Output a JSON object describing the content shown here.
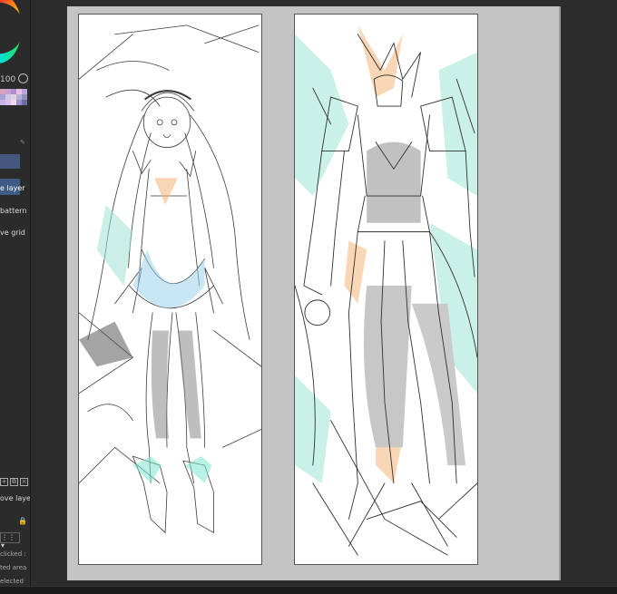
{
  "left_panel": {
    "zoom_value": "100",
    "menu_items": [
      {
        "label": "e layer",
        "active": true
      },
      {
        "label": "battern",
        "active": false
      },
      {
        "label": "ve grid",
        "active": false
      }
    ],
    "layer_label": "ove layer",
    "list_items": [
      {
        "label": "clicked :"
      },
      {
        "label": "ted area"
      },
      {
        "label": "elected"
      }
    ],
    "swatch_colors": [
      "#d9a0c0",
      "#c9a0d6",
      "#a78fd0",
      "#e7c0e0",
      "#b5a6e0",
      "#a89ed8",
      "#d0c6e6",
      "#e5d0e8",
      "#b0b0d0",
      "#8f8fc0",
      "#c9b7e3",
      "#d8c0f0",
      "#f0d8e8",
      "#9a8fcf",
      "#6c6ca0"
    ]
  },
  "canvas": {
    "panels": [
      {
        "name": "left-illustration",
        "subject": "girl figure sketch"
      },
      {
        "name": "right-illustration",
        "subject": "armored mech knight sketch"
      }
    ],
    "accent_colors": {
      "teal": "#7fe6d0",
      "orange": "#f5b57a",
      "blue": "#8ecbe6",
      "gray": "#8a8a8a"
    }
  }
}
